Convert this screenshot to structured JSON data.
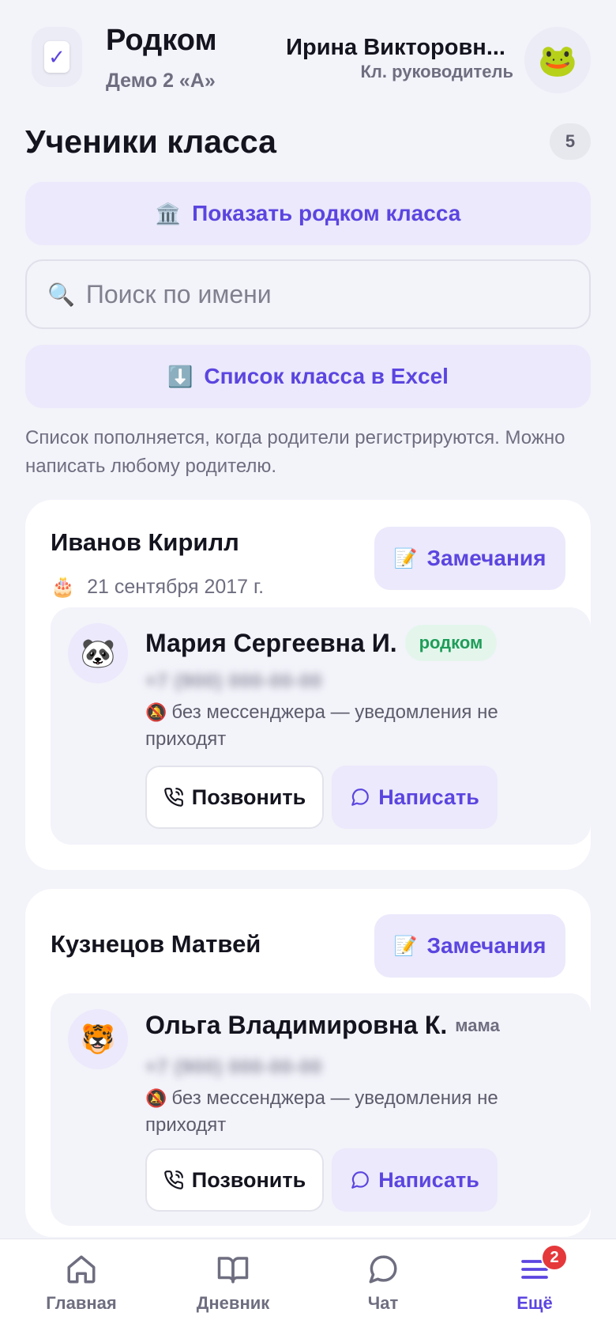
{
  "header": {
    "app_title": "Родком",
    "class_label": "Демо 2 «А»",
    "user_name": "Ирина Викторовн...",
    "user_role": "Кл. руководитель",
    "avatar_emoji": "🐸"
  },
  "section": {
    "title": "Ученики класса",
    "count": "5"
  },
  "buttons": {
    "show_committee_icon": "🏛️",
    "show_committee": "Показать родком класса",
    "excel_icon": "⬇️",
    "excel": "Список класса в Excel"
  },
  "search": {
    "icon": "🔍",
    "placeholder": "Поиск по имени",
    "value": ""
  },
  "hint": "Список пополняется, когда родители регистрируются. Можно написать любому родителю.",
  "students": [
    {
      "name": "Иванов Кирилл",
      "birthday_icon": "🎂",
      "birthday": "21 сентября 2017 г.",
      "notes_icon": "📝",
      "notes_label": "Замечания",
      "parent": {
        "avatar_emoji": "🐼",
        "name": "Мария Сергеевна И.",
        "role": "родком",
        "phone": "+7 (900) 000-00-00",
        "no_messenger_icon": "🔕",
        "no_messenger": "без мессенджера — уведомления не приходят",
        "call_label": "Позвонить",
        "write_label": "Написать"
      }
    },
    {
      "name": "Кузнецов Матвей",
      "notes_icon": "📝",
      "notes_label": "Замечания",
      "parent": {
        "avatar_emoji": "🐯",
        "name": "Ольга Владимировна К.",
        "role": "мама",
        "phone": "+7 (900) 000-00-00",
        "no_messenger_icon": "🔕",
        "no_messenger": "без мессенджера — уведомления не приходят",
        "call_label": "Позвонить",
        "write_label": "Написать"
      }
    }
  ],
  "nav": {
    "home": "Главная",
    "diary": "Дневник",
    "chat": "Чат",
    "more": "Ещё",
    "more_badge": "2"
  },
  "colors": {
    "accent": "#5b45e0",
    "background": "#f3f3fa",
    "badge_red": "#e5383b",
    "committee_green": "#1f9d5a"
  }
}
